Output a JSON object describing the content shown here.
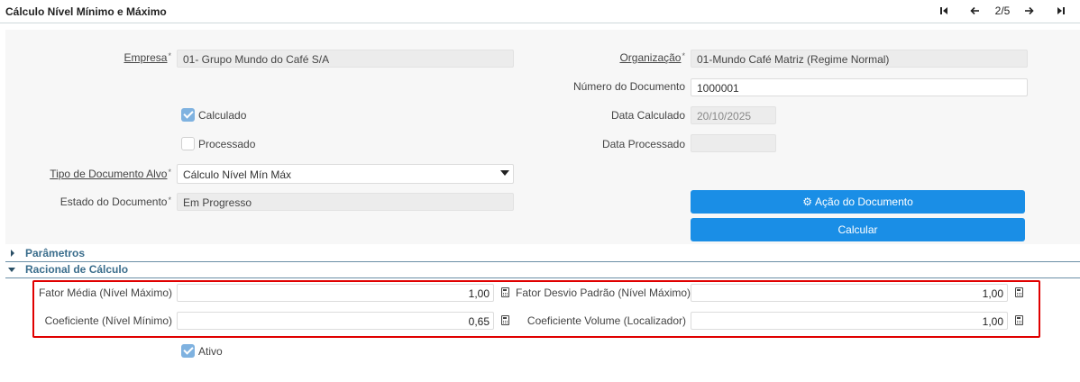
{
  "header": {
    "title": "Cálculo Nível Mínimo e Máximo",
    "first_icon": "first-record-icon",
    "prev_icon": "arrow-left-icon",
    "record_position": "2/5",
    "next_icon": "arrow-right-icon",
    "last_icon": "last-record-icon"
  },
  "form": {
    "empresa_label": "Empresa",
    "empresa_value": "01- Grupo Mundo do Café S/A",
    "organizacao_label": "Organização",
    "organizacao_value": "01-Mundo Café Matriz (Regime Normal)",
    "numero_documento_label": "Número do Documento",
    "numero_documento_value": "1000001",
    "calculado_label": "Calculado",
    "calculado_checked": true,
    "data_calculado_label": "Data Calculado",
    "data_calculado_value": "20/10/2025",
    "processado_label": "Processado",
    "processado_checked": false,
    "data_processado_label": "Data Processado",
    "data_processado_value": "",
    "tipo_documento_label": "Tipo de Documento Alvo",
    "tipo_documento_value": "Cálculo Nível Mín Máx",
    "estado_documento_label": "Estado do Documento",
    "estado_documento_value": "Em Progresso",
    "required_mark": "*"
  },
  "buttons": {
    "acao_documento": "Ação do Documento",
    "acao_icon": "gear-icon",
    "calcular": "Calcular"
  },
  "sections": {
    "parametros": "Parâmetros",
    "racional": "Racional de Cálculo"
  },
  "racional": {
    "fator_media_label": "Fator Média (Nível Máximo)",
    "fator_media_value": "1,00",
    "fator_desvio_label": "Fator Desvio Padrão (Nível Máximo)",
    "fator_desvio_value": "1,00",
    "coeficiente_label": "Coeficiente (Nível Mínimo)",
    "coeficiente_value": "0,65",
    "coeficiente_volume_label": "Coeficiente Volume (Localizador)",
    "coeficiente_volume_value": "1,00",
    "ativo_label": "Ativo",
    "ativo_checked": true,
    "calc_icon": "calculator-icon"
  },
  "colors": {
    "primary_button": "#1a8ee6",
    "highlight_border": "#e00000",
    "checkbox_checked": "#7fb2e0",
    "section_title": "#3a6d8c"
  }
}
